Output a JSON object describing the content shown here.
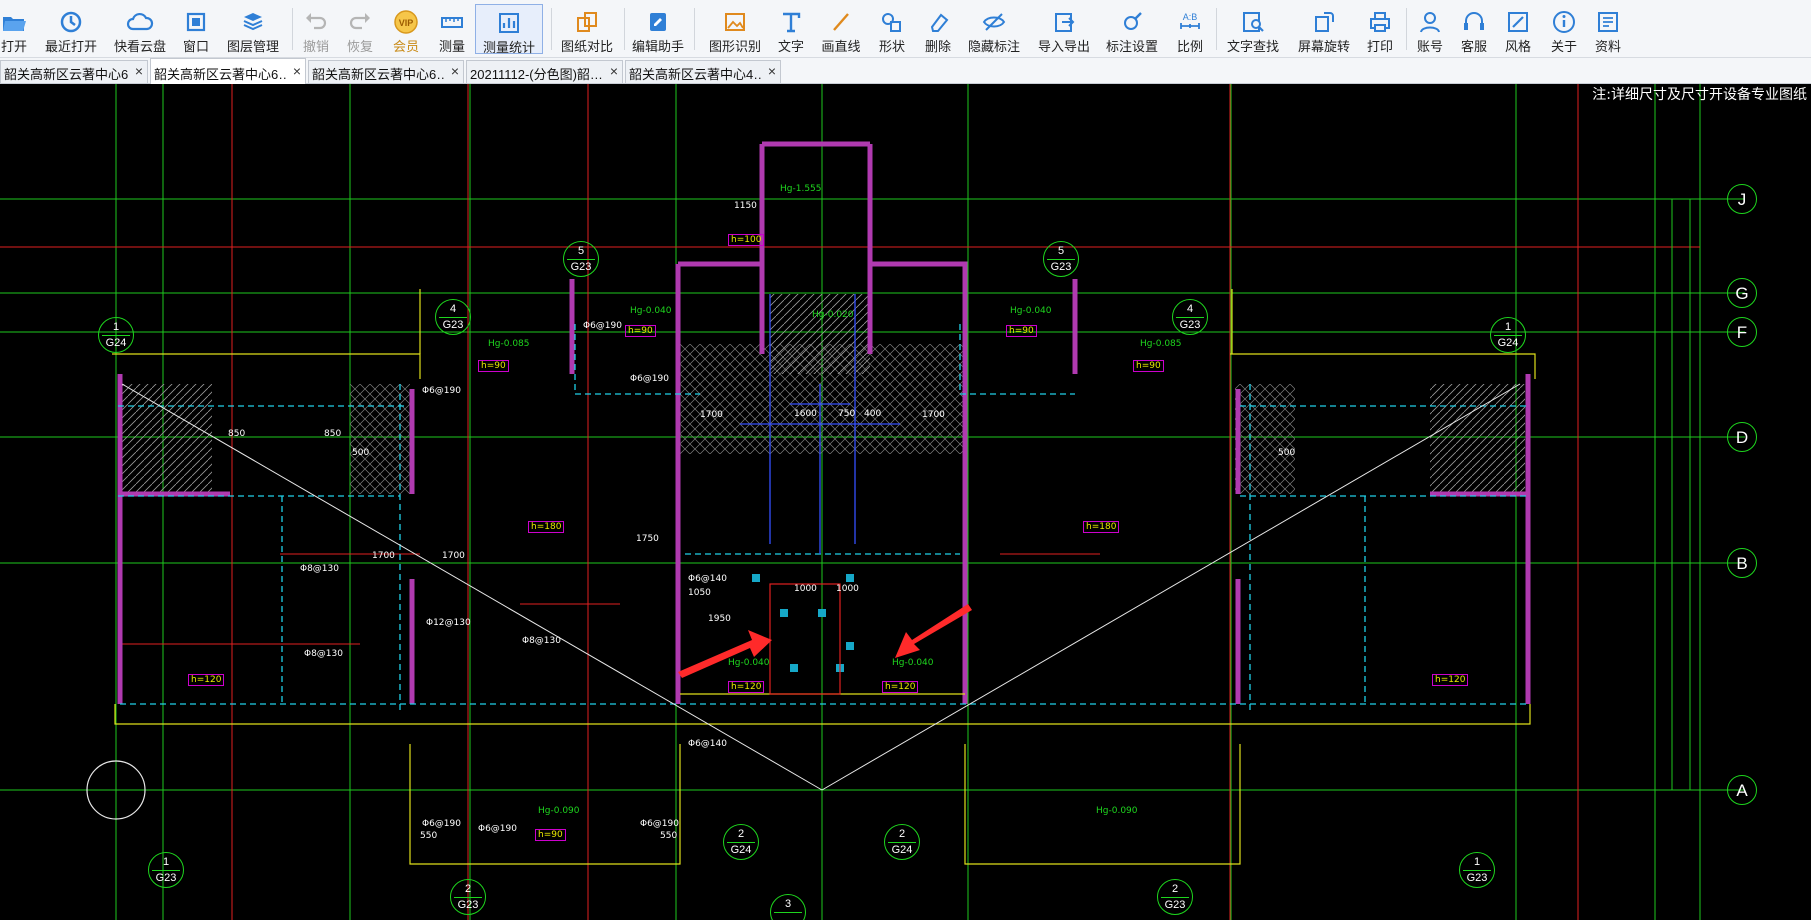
{
  "toolbar": {
    "open": "打开",
    "recent": "最近打开",
    "cloud": "快看云盘",
    "window": "窗口",
    "layers": "图层管理",
    "undo": "撤销",
    "redo": "恢复",
    "vip": "会员",
    "vip_badge": "VIP",
    "measure": "测量",
    "measure_stats": "测量统计",
    "compare": "图纸对比",
    "edit_helper": "编辑助手",
    "shape_recognize": "图形识别",
    "text": "文字",
    "draw_line": "画直线",
    "shape": "形状",
    "delete": "删除",
    "hide_annot": "隐藏标注",
    "import_export": "导入导出",
    "annot_settings": "标注设置",
    "scale": "比例",
    "text_search": "文字查找",
    "rotate": "屏幕旋转",
    "print": "打印",
    "account": "账号",
    "service": "客服",
    "style": "风格",
    "about": "关于",
    "resources": "资料"
  },
  "tabs": [
    {
      "label": "韶关高新区云著中心6…",
      "active": false
    },
    {
      "label": "韶关高新区云著中心6…",
      "active": true
    },
    {
      "label": "韶关高新区云著中心6…",
      "active": false
    },
    {
      "label": "20211112-(分色图)韶…",
      "active": false
    },
    {
      "label": "韶关高新区云著中心4…",
      "active": false
    }
  ],
  "tab_close": "×",
  "drawing": {
    "corner_note": "注:详细尺寸及尺寸开设备专业图纸",
    "axis_labels": {
      "J": "J",
      "G": "G",
      "F": "F",
      "D": "D",
      "B": "B",
      "A": "A"
    },
    "callouts": {
      "c5a": {
        "n": "5",
        "d": "G23"
      },
      "c5b": {
        "n": "5",
        "d": "G23"
      },
      "c1a": {
        "n": "1",
        "d": "G24"
      },
      "c4a": {
        "n": "4",
        "d": "G23"
      },
      "c4b": {
        "n": "4",
        "d": "G23"
      },
      "c1b": {
        "n": "1",
        "d": "G24"
      },
      "c2a": {
        "n": "2",
        "d": "G24"
      },
      "c2b": {
        "n": "2",
        "d": "G24"
      },
      "c1c": {
        "n": "1",
        "d": "G23"
      },
      "c2c": {
        "n": "2",
        "d": "G23"
      },
      "c2d": {
        "n": "2",
        "d": "G23"
      },
      "c1d": {
        "n": "1",
        "d": "G23"
      },
      "c3": {
        "n": "3",
        "d": ""
      }
    },
    "rebar": {
      "r1": "Φ6@190",
      "r2": "Φ6@190",
      "r3": "Φ6@190",
      "r4": "Φ8@130",
      "r5": "Φ12@130",
      "r6": "Φ8@130",
      "r7": "Φ8@130",
      "r8": "Φ6@140",
      "r9": "Φ6@140",
      "r10": "Φ6@190",
      "r11": "Φ6@190",
      "r12": "Φ6@190"
    },
    "slabs": {
      "h90a": "h=90",
      "h90b": "h=90",
      "h90c": "h=90",
      "h90d": "h=90",
      "h90e": "h=90",
      "h100": "h=100",
      "h120a": "h=120",
      "h120b": "h=120",
      "h120c": "h=120",
      "h120d": "h=120",
      "h180a": "h=180",
      "h180b": "h=180"
    },
    "heights": {
      "hg1": "Hg-0.040",
      "hg2": "Hg-0.040",
      "hg3": "Hg-0.085",
      "hg4": "Hg-0.085",
      "hg5": "Hg-0.040",
      "hg6": "Hg-0.040",
      "hg7": "Hg-0.090",
      "hg8": "Hg-0.090",
      "hg9": "Hg-0.020",
      "hg10": "Hg-1.555"
    },
    "dims": {
      "d1700a": "1700",
      "d1700b": "1700",
      "d1700c": "1700",
      "d1700d": "1700",
      "d850a": "850",
      "d850b": "850",
      "d1000a": "1000",
      "d1000b": "1000",
      "d1750": "1750",
      "d1950": "1950",
      "d1050": "1050",
      "d500a": "500",
      "d500b": "500",
      "d550a": "550",
      "d550b": "550",
      "d1150": "1150",
      "d1600": "1600",
      "d750": "750",
      "d400": "400"
    }
  }
}
